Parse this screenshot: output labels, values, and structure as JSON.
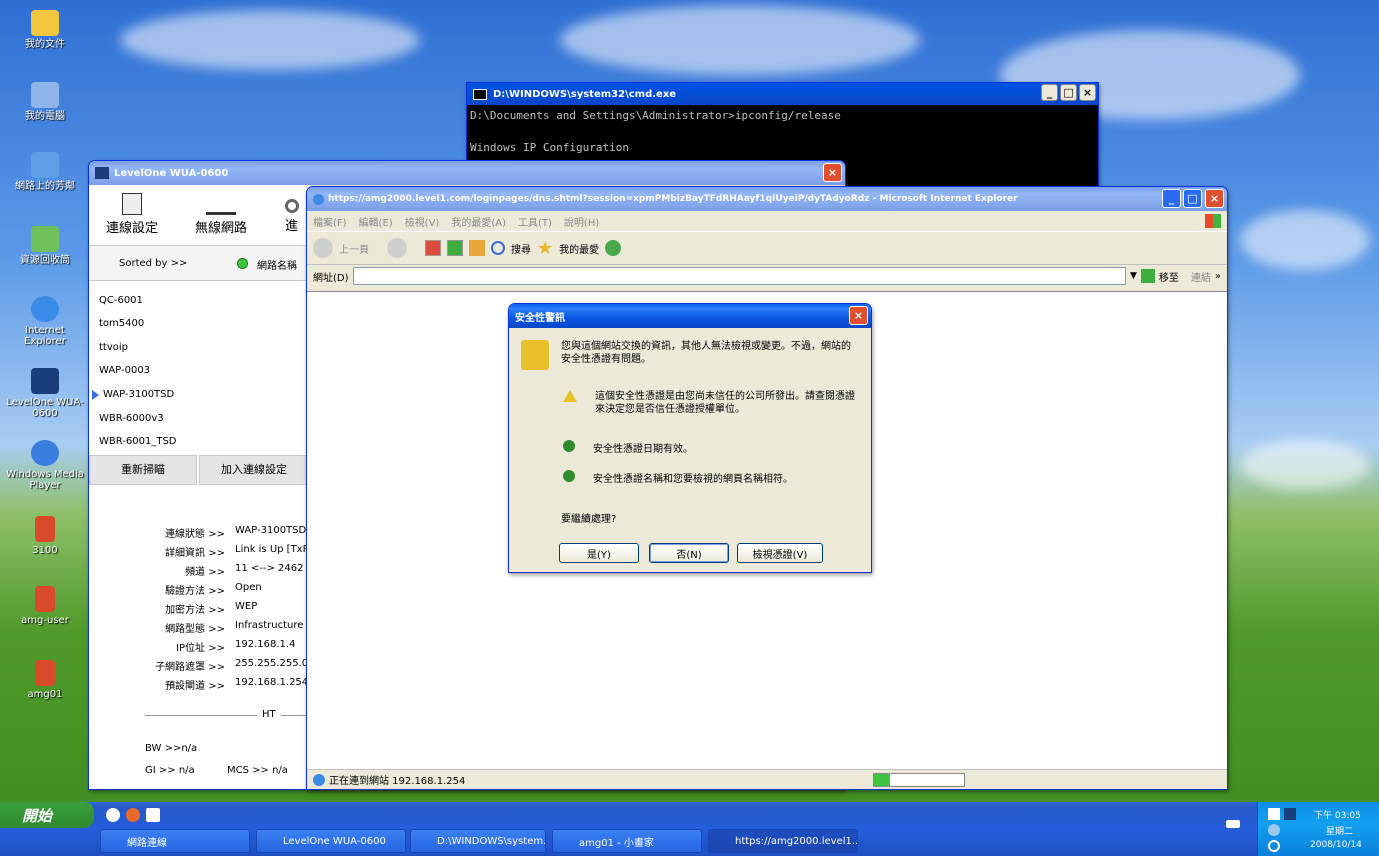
{
  "desktop": {
    "icons": [
      {
        "label": "我的文件",
        "icon": "folder-icon",
        "color": "#f3c640"
      },
      {
        "label": "我的電腦",
        "icon": "computer-icon",
        "color": "#8fb5e8"
      },
      {
        "label": "網路上的芳鄰",
        "icon": "network-icon",
        "color": "#5ea0e8"
      },
      {
        "label": "資源回收筒",
        "icon": "recycle-bin-icon",
        "color": "#6ec05a"
      },
      {
        "label": "Internet Explorer",
        "icon": "ie-icon",
        "color": "#3a8ae8"
      },
      {
        "label": "LevelOne WUA-0600",
        "icon": "levelone-icon",
        "color": "#1a3e7a"
      },
      {
        "label": "Windows Media Player",
        "icon": "media-player-icon",
        "color": "#3b7ee0"
      },
      {
        "label": "3100",
        "icon": "document-icon",
        "color": "#d84a2a"
      },
      {
        "label": "amg-user",
        "icon": "document-icon",
        "color": "#d84a2a"
      },
      {
        "label": "amg01",
        "icon": "document-icon",
        "color": "#d84a2a"
      }
    ]
  },
  "cmd": {
    "title": "D:\\WINDOWS\\system32\\cmd.exe",
    "lines": [
      "D:\\Documents and Settings\\Administrator>ipconfig/release",
      "Windows IP Configuration"
    ]
  },
  "levelone": {
    "title": "LevelOne WUA-0600",
    "toolbar": [
      "連線設定",
      "無線網路",
      "進"
    ],
    "sorted_by": "Sorted by >>",
    "sort_label": "網路名稱",
    "networks": [
      "QC-6001",
      "tom5400",
      "ttvoip",
      "WAP-0003",
      "WAP-3100TSD",
      "WBR-6000v3",
      "WBR-6001_TSD"
    ],
    "selected_network": "WAP-3100TSD",
    "rescan": "重新掃瞄",
    "add_profile": "加入連線設定",
    "status": [
      {
        "label": "連線狀態 >>",
        "value": "WAP-3100TSD"
      },
      {
        "label": "詳細資訊 >>",
        "value": "Link is Up [TxP"
      },
      {
        "label": "頻道 >>",
        "value": "11 <--> 2462 M"
      },
      {
        "label": "驗證方法 >>",
        "value": "Open"
      },
      {
        "label": "加密方法 >>",
        "value": "WEP"
      },
      {
        "label": "網路型態 >>",
        "value": "Infrastructure"
      },
      {
        "label": "IP位址 >>",
        "value": "192.168.1.4"
      },
      {
        "label": "子網路遮罩 >>",
        "value": "255.255.255.0"
      },
      {
        "label": "預設閘道 >>",
        "value": "192.168.1.254"
      }
    ],
    "ht_label": "HT",
    "bw": "BW >>n/a",
    "gi": "GI >> n/a",
    "mcs": "MCS >>  n/a"
  },
  "ie": {
    "title": "https://amg2000.level1.com/loginpages/dns.shtml?session=xpmPMbizBayTFdRHAayf1qIUyeiP/dyTAdyoRdz - Microsoft Internet Explorer",
    "menu": [
      "檔案(F)",
      "編輯(E)",
      "檢視(V)",
      "我的最愛(A)",
      "工具(T)",
      "說明(H)"
    ],
    "back": "上一頁",
    "search": "搜尋",
    "favorites": "我的最愛",
    "address_label": "網址(D)",
    "go": "移至",
    "links": "連結",
    "status_text": "正在連到網站 192.168.1.254"
  },
  "dialog": {
    "title": "安全性警訊",
    "intro": "您與這個網站交換的資訊，其他人無法檢視或變更。不過，網站的安全性憑證有問題。",
    "items": [
      {
        "icon": "warning-icon",
        "text": "這個安全性憑證是由您尚未信任的公司所發出。請查閱憑證來決定您是否信任憑證授權單位。"
      },
      {
        "icon": "check-icon",
        "text": "安全性憑證日期有效。"
      },
      {
        "icon": "check-icon",
        "text": "安全性憑證名稱和您要檢視的網頁名稱相符。"
      }
    ],
    "question": "要繼續處理?",
    "buttons": {
      "yes": "是(Y)",
      "no": "否(N)",
      "view": "檢視憑證(V)"
    }
  },
  "taskbar": {
    "start": "開始",
    "buttons": [
      "網路連線",
      "LevelOne WUA-0600",
      "D:\\WINDOWS\\system...",
      "amg01 - 小畫家",
      "https://amg2000.level1..."
    ],
    "clock_time": "下午 03:05",
    "clock_day": "星期二",
    "clock_date": "2008/10/14"
  }
}
